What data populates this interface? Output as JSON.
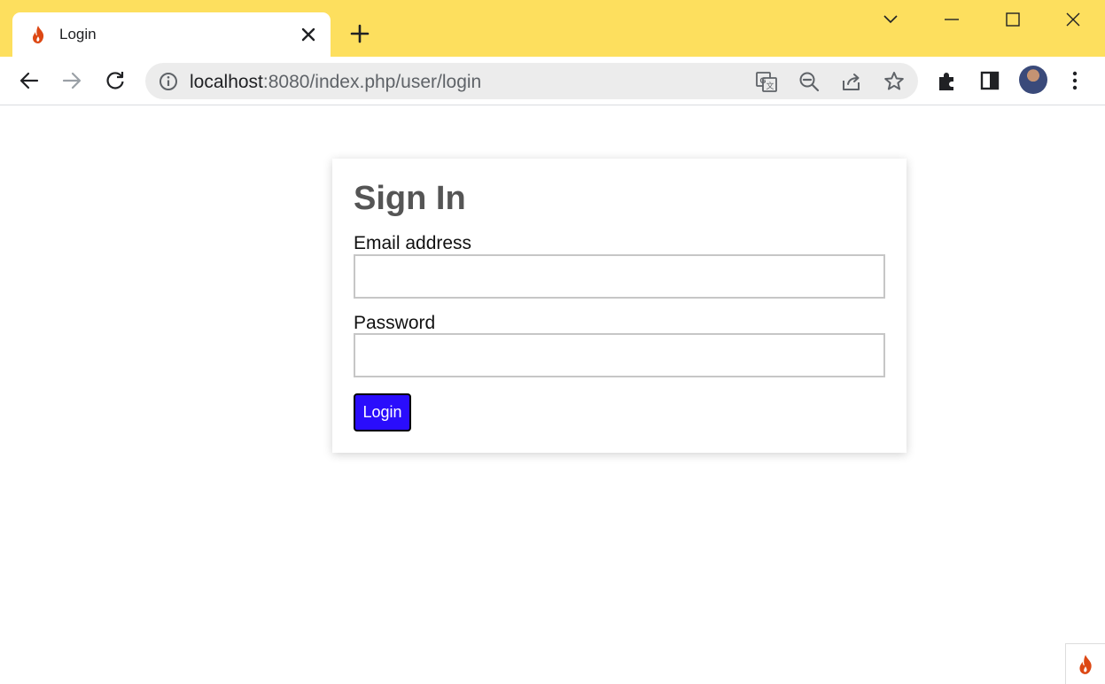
{
  "browser": {
    "tab": {
      "title": "Login",
      "favicon": "codeigniter-flame-icon"
    },
    "window_controls": [
      "tab-search-icon",
      "minimize-icon",
      "maximize-icon",
      "close-window-icon"
    ],
    "toolbar": {
      "url_host": "localhost",
      "url_rest": ":8080/index.php/user/login",
      "icons": [
        "back-arrow-icon",
        "forward-arrow-icon",
        "reload-icon",
        "info-icon",
        "translate-icon",
        "zoom-out-icon",
        "share-icon",
        "bookmark-star-icon",
        "extensions-puzzle-icon",
        "side-panel-icon",
        "avatar",
        "kebab-menu-icon"
      ]
    }
  },
  "colors": {
    "tabstrip": "#fddf5e",
    "button": "#2a0dfc",
    "title": "#555555"
  },
  "login": {
    "title": "Sign In",
    "email_label": "Email address",
    "email_value": "",
    "password_label": "Password",
    "password_value": "",
    "submit_label": "Login"
  }
}
